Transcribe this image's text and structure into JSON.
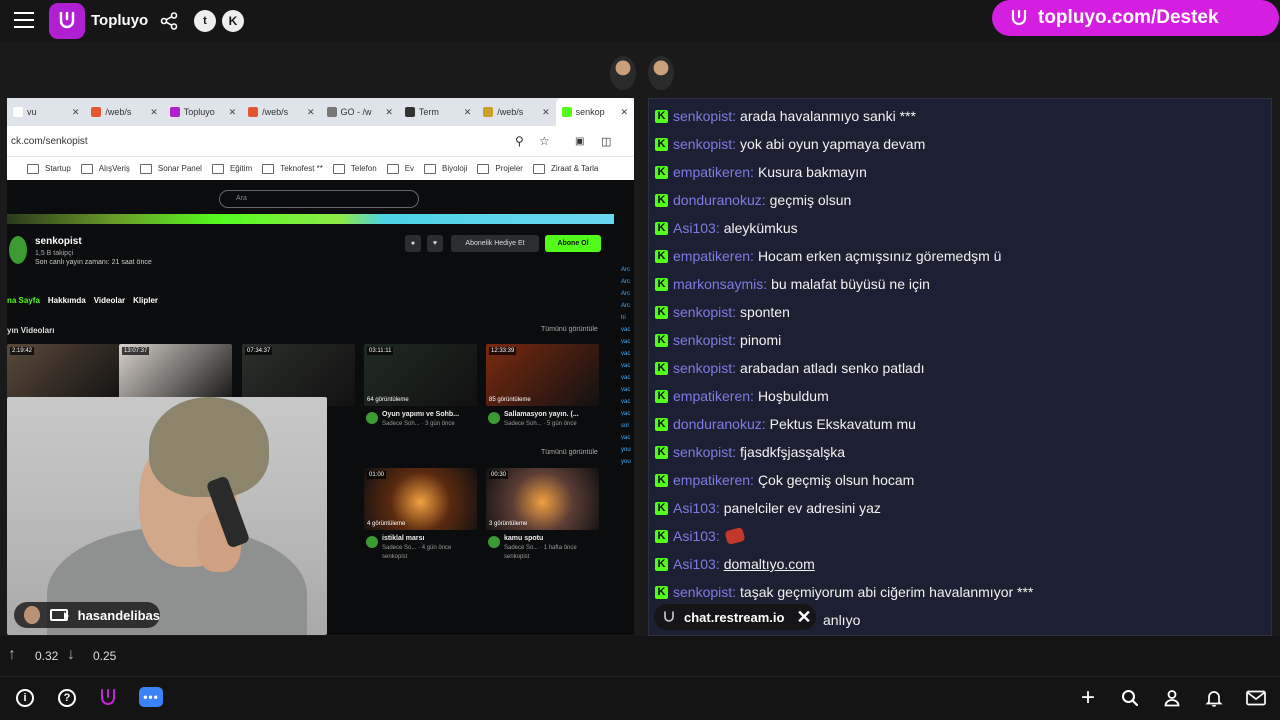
{
  "topbar": {
    "brand": "Topluyo",
    "promo": "topluyo.com/Destek",
    "twitter_label": "t",
    "kick_label": "K"
  },
  "browser": {
    "tabs": [
      {
        "label": "vu",
        "color": "#ffffff"
      },
      {
        "label": "/web/s",
        "color": "#e4572e"
      },
      {
        "label": "Topluyo",
        "color": "#b01fd1"
      },
      {
        "label": "/web/s",
        "color": "#e4572e"
      },
      {
        "label": "GO - /w",
        "color": "#777777"
      },
      {
        "label": "Term",
        "color": "#333333"
      },
      {
        "label": "/web/s",
        "color": "#c9a227"
      },
      {
        "label": "senkop",
        "color": "#53fc18"
      }
    ],
    "url": "ck.com/senkopist",
    "bookmarks": [
      "Startup",
      "AlışVeriş",
      "Sonar Panel",
      "Eğitim",
      "Teknofest **",
      "Telefon",
      "Ev",
      "Biyoloji",
      "Projeler",
      "Ziraat & Tarla"
    ],
    "search_placeholder": "Ara",
    "channel": {
      "name": "senkopist",
      "followers": "1,5 B takipçi",
      "last_live": "Son canlı yayın zamanı: 21 saat önce",
      "gift_button": "Abonelik Hediye Et",
      "follow_button": "Abone Ol"
    },
    "channel_tabs": [
      "na Sayfa",
      "Hakkımda",
      "Videolar",
      "Klipler"
    ],
    "section_title": "yın Videoları",
    "see_all": "Tümünü görüntüle",
    "row1": [
      {
        "duration": "2:19:42",
        "color": "#5a4a3a"
      },
      {
        "duration": "13:07:37",
        "color": "#d8d2cc"
      },
      {
        "duration": "07:34:37",
        "color": "#2b2f2a"
      },
      {
        "duration": "03:11:11",
        "color": "#1f2a22",
        "views": "64 görüntüleme",
        "title": "Oyun yapımı ve Sohb...",
        "sub": "Sadece Soh... · 3 gün önce"
      },
      {
        "duration": "12:33:39",
        "color": "#7a2a10",
        "views": "85 görüntüleme",
        "title": "Sallamasyon yayın. (...",
        "sub": "Sadece Soh... · 5 gün önce"
      }
    ],
    "row2": [
      {
        "duration": "01:00",
        "color": "#5b2a10",
        "views": "4 görüntüleme",
        "title": "istiklal marsı",
        "sub": "Sadece So... · 4 gün önce",
        "author": "senkopist"
      },
      {
        "duration": "00:30",
        "color": "#5c3d35",
        "views": "3 görüntüleme",
        "title": "kamu spotu",
        "sub": "Sadece So... · 1 hafta önce",
        "author": "senkopist"
      }
    ]
  },
  "webcam": {
    "name": "hasandelibas"
  },
  "chat": {
    "messages": [
      {
        "user": "senkopist",
        "text": "arada havalanmıyo sanki ***"
      },
      {
        "user": "senkopist",
        "text": "yok abi oyun yapmaya devam"
      },
      {
        "user": "empatikeren",
        "text": "Kusura bakmayın"
      },
      {
        "user": "donduranokuz",
        "text": "geçmiş olsun"
      },
      {
        "user": "Asi103",
        "text": "aleykümkus"
      },
      {
        "user": "empatikeren",
        "text": "Hocam erken açmışsınız göremedşm ü"
      },
      {
        "user": "markonsaymis",
        "text": "bu malafat büyüsü ne için"
      },
      {
        "user": "senkopist",
        "text": "sponten"
      },
      {
        "user": "senkopist",
        "text": "pinomi"
      },
      {
        "user": "senkopist",
        "text": "arabadan atladı senko patladı"
      },
      {
        "user": "empatikeren",
        "text": "Hoşbuldum"
      },
      {
        "user": "donduranokuz",
        "text": "Pektus Ekskavatum mu"
      },
      {
        "user": "senkopist",
        "text": "fjasdkfşjasşalşka"
      },
      {
        "user": "empatikeren",
        "text": "Çok geçmiş olsun hocam"
      },
      {
        "user": "Asi103",
        "text": "panelciler ev adresini yaz"
      },
      {
        "user": "Asi103",
        "text": ""
      },
      {
        "user": "Asi103",
        "text": "domaltıyo.com"
      },
      {
        "user": "senkopist",
        "text": "taşak geçmiyorum abi ciğerim havalanmıyor ***"
      },
      {
        "user": "",
        "text": "anlıyo"
      }
    ],
    "source": "chat.restream.io"
  },
  "stats": {
    "up": "0.32",
    "down": "0.25"
  },
  "bottombar": {
    "info_icon": "i",
    "help_icon": "?",
    "chat_icon": "•••"
  }
}
